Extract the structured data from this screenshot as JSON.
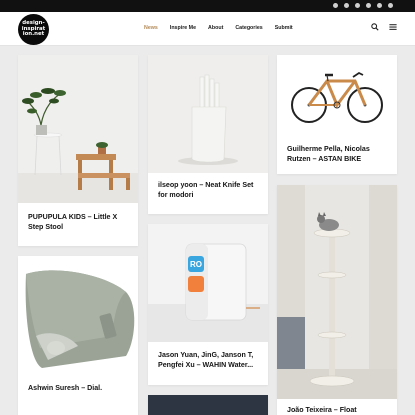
{
  "site": {
    "logo_text": "design-inspiration.net"
  },
  "nav": {
    "items": [
      {
        "label": "News",
        "active": true
      },
      {
        "label": "Inspire Me",
        "active": false
      },
      {
        "label": "About",
        "active": false
      },
      {
        "label": "Categories",
        "active": false
      },
      {
        "label": "Submit",
        "active": false
      }
    ],
    "active_color": "#b38a58"
  },
  "topbar": {
    "social_icons": [
      "instagram-icon",
      "twitter-icon",
      "facebook-icon",
      "pinterest-icon",
      "behance-icon",
      "rss-icon"
    ]
  },
  "header_icons": [
    "search-icon",
    "menu-icon"
  ],
  "posts": [
    {
      "title": "PUPUPULA KIDS – Little X Step Stool"
    },
    {
      "title": "ilseop yoon – Neat Knife Set for modori"
    },
    {
      "title": "Guilherme Pella, Nicolas Rutzen – ASTAN BIKE"
    },
    {
      "title": "Ashwin Suresh – Dial."
    },
    {
      "title": "Jason Yuan, JinG, Janson T, Pengfei Xu – WAHIN Water..."
    },
    {
      "title": "João Teixeira – Float"
    }
  ],
  "product_texts": {
    "wahin_badge": "RO"
  }
}
